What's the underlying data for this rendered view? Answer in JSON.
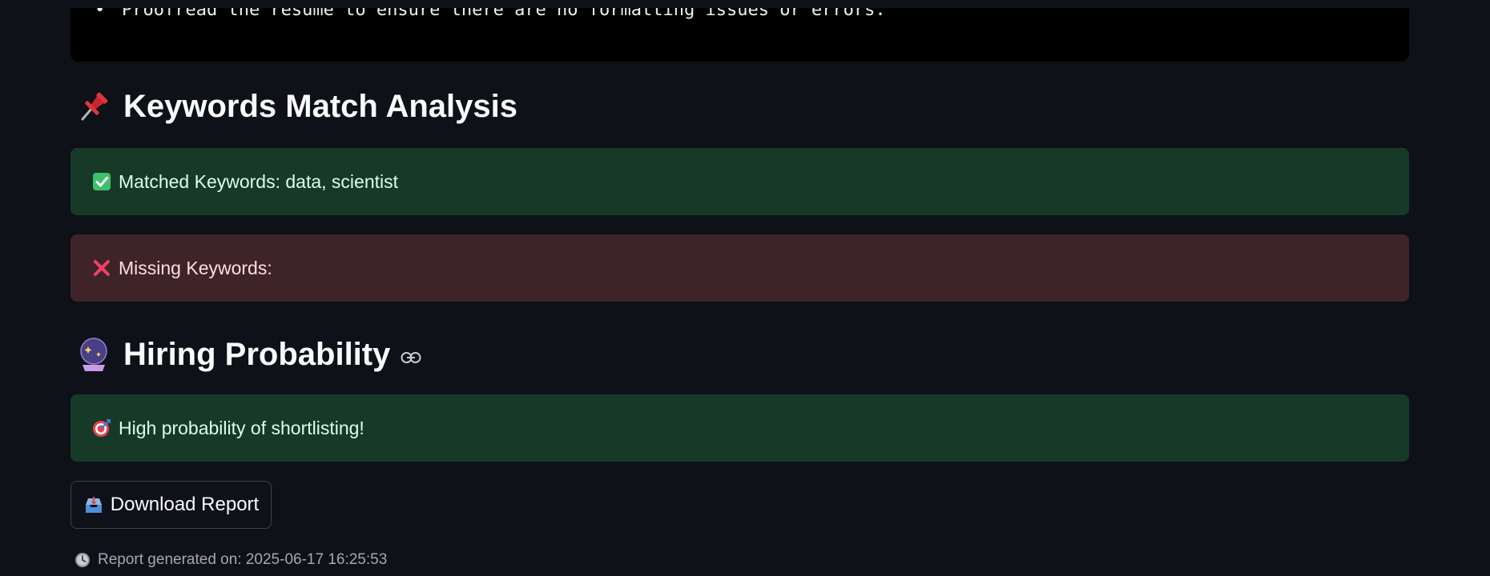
{
  "code_block": {
    "bullet": "•",
    "line": "Proofread the resume to ensure there are no formatting issues or errors."
  },
  "keywords_section": {
    "title": "Keywords Match Analysis",
    "icon": "pushpin-icon",
    "matched": {
      "icon": "check-mark-button-icon",
      "text": "Matched Keywords: data, scientist"
    },
    "missing": {
      "icon": "cross-mark-icon",
      "text": "Missing Keywords:"
    }
  },
  "hiring_section": {
    "title": "Hiring Probability",
    "icon": "crystal-ball-icon",
    "anchor_icon": "link-icon",
    "result": {
      "icon": "direct-hit-icon",
      "text": "High probability of shortlisting!"
    }
  },
  "download_button": {
    "icon": "inbox-tray-icon",
    "label": "Download Report"
  },
  "footer": {
    "icon": "clock-icon",
    "text": "Report generated on: 2025-06-17 16:25:53"
  },
  "colors": {
    "background": "#0e1117",
    "success_bg": "#173928",
    "error_bg": "#3e2428",
    "code_bg": "#000000"
  }
}
